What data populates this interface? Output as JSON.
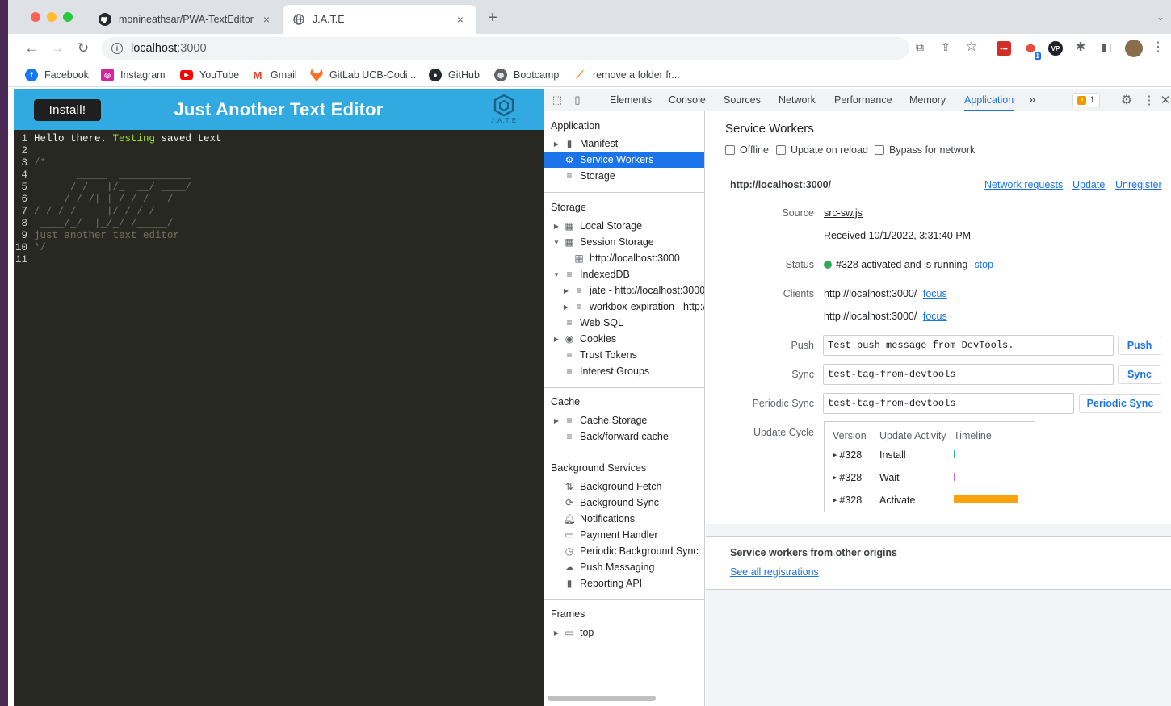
{
  "browser": {
    "tabs": [
      {
        "title": "monineathsar/PWA-TextEditor",
        "close": "×"
      },
      {
        "title": "J.A.T.E",
        "close": "×"
      }
    ],
    "new_tab": "+",
    "tab_menu": "⌄",
    "url_host": "localhost",
    "url_port": ":3000",
    "bookmarks": [
      {
        "label": "Facebook",
        "icon": "facebook-icon",
        "color": "#1877f2"
      },
      {
        "label": "Instagram",
        "icon": "instagram-icon",
        "color": "#d6249f"
      },
      {
        "label": "YouTube",
        "icon": "youtube-icon",
        "color": "#ff0000"
      },
      {
        "label": "Gmail",
        "icon": "gmail-icon",
        "color": "#ea4335"
      },
      {
        "label": "GitLab UCB-Codi...",
        "icon": "gitlab-icon",
        "color": "#fc6d26"
      },
      {
        "label": "GitHub",
        "icon": "github-icon",
        "color": "#24292e"
      },
      {
        "label": "Bootcamp",
        "icon": "globe-icon",
        "color": "#5f6368"
      },
      {
        "label": "remove a folder fr...",
        "icon": "stackoverflow-icon",
        "color": "#f48024"
      }
    ],
    "extension_badge": "1"
  },
  "app": {
    "install_label": "Install!",
    "title": "Just Another Text Editor",
    "logo_text": "J.A.T.E",
    "editor_lines": [
      {
        "num": "1",
        "parts": [
          {
            "t": "Hello there. ",
            "c": "ct"
          },
          {
            "t": "Testing",
            "c": "kw"
          },
          {
            "t": " saved text",
            "c": "ct"
          }
        ]
      },
      {
        "num": "2",
        "parts": [
          {
            "t": "",
            "c": "ct"
          }
        ]
      },
      {
        "num": "3",
        "parts": [
          {
            "t": "/*",
            "c": "cm"
          }
        ]
      },
      {
        "num": "4",
        "parts": [
          {
            "t": "       _____  ____________",
            "c": "cm"
          }
        ]
      },
      {
        "num": "5",
        "parts": [
          {
            "t": "      / /   |/_  __/ ____/",
            "c": "cm"
          }
        ]
      },
      {
        "num": "6",
        "parts": [
          {
            "t": " __  / / /| | / / / __/",
            "c": "cm"
          }
        ]
      },
      {
        "num": "7",
        "parts": [
          {
            "t": "/ /_/ / ___ |/ / / /___",
            "c": "cm"
          }
        ]
      },
      {
        "num": "8",
        "parts": [
          {
            "t": " ____/_/  |_/_/ /_____/",
            "c": "cm"
          }
        ]
      },
      {
        "num": "9",
        "parts": [
          {
            "t": "just another text editor",
            "c": "cm"
          }
        ]
      },
      {
        "num": "10",
        "parts": [
          {
            "t": "*/",
            "c": "cm"
          }
        ]
      },
      {
        "num": "11",
        "parts": [
          {
            "t": "",
            "c": "ct"
          }
        ]
      }
    ]
  },
  "devtools": {
    "tabs": [
      "Elements",
      "Console",
      "Sources",
      "Network",
      "Performance",
      "Memory",
      "Application"
    ],
    "active_tab": "Application",
    "more_tabs": "»",
    "warning_count": "1",
    "sidebar": {
      "application_header": "Application",
      "application_items": [
        "Manifest",
        "Service Workers",
        "Storage"
      ],
      "storage_header": "Storage",
      "storage_items": [
        "Local Storage",
        "Session Storage",
        "http://localhost:3000",
        "IndexedDB",
        "jate - http://localhost:3000",
        "workbox-expiration - http:/",
        "Web SQL",
        "Cookies",
        "Trust Tokens",
        "Interest Groups"
      ],
      "cache_header": "Cache",
      "cache_items": [
        "Cache Storage",
        "Back/forward cache"
      ],
      "bg_header": "Background Services",
      "bg_items": [
        "Background Fetch",
        "Background Sync",
        "Notifications",
        "Payment Handler",
        "Periodic Background Sync",
        "Push Messaging",
        "Reporting API"
      ],
      "frames_header": "Frames",
      "frames_items": [
        "top"
      ]
    },
    "main": {
      "title": "Service Workers",
      "options": [
        "Offline",
        "Update on reload",
        "Bypass for network"
      ],
      "origin": "http://localhost:3000/",
      "origin_links": [
        "Network requests",
        "Update",
        "Unregister"
      ],
      "source_label": "Source",
      "source_link": "src-sw.js",
      "received": "Received 10/1/2022, 3:31:40 PM",
      "status_label": "Status",
      "status_text": "#328 activated and is running",
      "status_link": "stop",
      "status_color": "#34a853",
      "clients_label": "Clients",
      "clients": [
        {
          "url": "http://localhost:3000/",
          "action": "focus"
        },
        {
          "url": "http://localhost:3000/",
          "action": "focus"
        }
      ],
      "push_label": "Push",
      "push_value": "Test push message from DevTools.",
      "push_button": "Push",
      "sync_label": "Sync",
      "sync_value": "test-tag-from-devtools",
      "sync_button": "Sync",
      "psync_label": "Periodic Sync",
      "psync_value": "test-tag-from-devtools",
      "psync_button": "Periodic Sync",
      "update_cycle_label": "Update Cycle",
      "update_cycle_headers": [
        "Version",
        "Update Activity",
        "Timeline"
      ],
      "update_cycle_rows": [
        {
          "version": "#328",
          "activity": "Install",
          "color": "#24b5c6"
        },
        {
          "version": "#328",
          "activity": "Wait",
          "color": "#c86dd7"
        },
        {
          "version": "#328",
          "activity": "Activate",
          "color": "#f9a20b"
        }
      ],
      "other_origins_header": "Service workers from other origins",
      "see_all_link": "See all registrations"
    }
  }
}
